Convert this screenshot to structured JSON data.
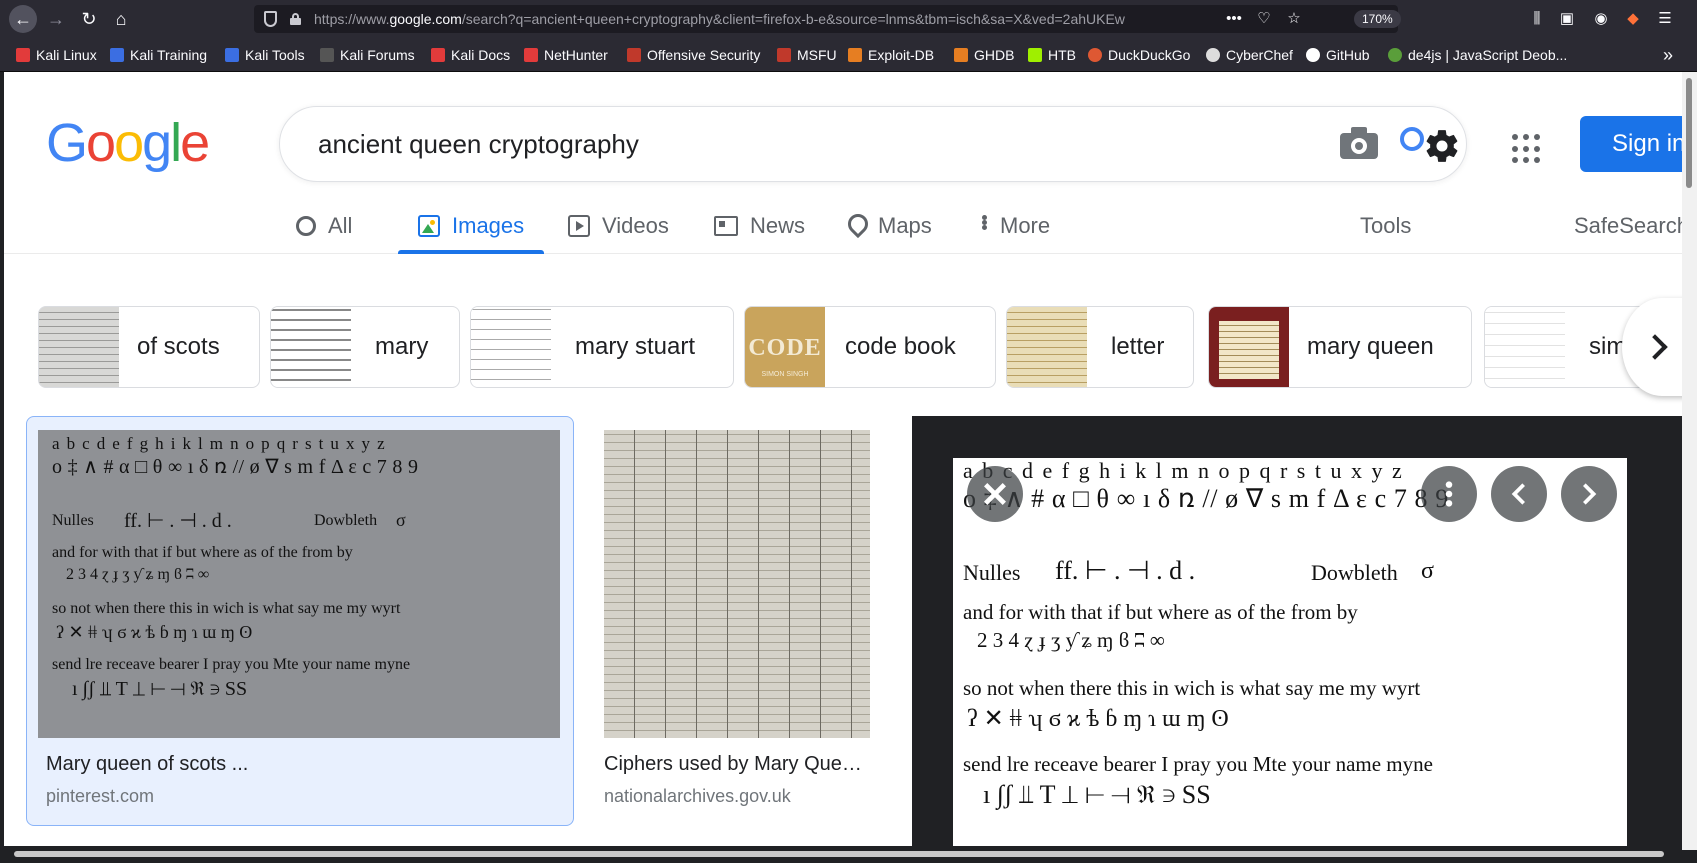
{
  "browser": {
    "url_prefix": "https://www.",
    "url_domain": "google.com",
    "url_rest": "/search?q=ancient+queen+cryptography&client=firefox-b-e&source=lnms&tbm=isch&sa=X&ved=2ahUKEw",
    "zoom": "170%",
    "bookmarks": [
      {
        "label": "Kali Linux",
        "color": "#e23b3b"
      },
      {
        "label": "Kali Training",
        "color": "#3b6ee2"
      },
      {
        "label": "Kali Tools",
        "color": "#3b6ee2"
      },
      {
        "label": "Kali Forums",
        "color": "#2b2a33"
      },
      {
        "label": "Kali Docs",
        "color": "#e23b3b"
      },
      {
        "label": "NetHunter",
        "color": "#e23b3b"
      },
      {
        "label": "Offensive Security",
        "color": "#c0392b"
      },
      {
        "label": "MSFU",
        "color": "#c0392b"
      },
      {
        "label": "Exploit-DB",
        "color": "#e67e22"
      },
      {
        "label": "GHDB",
        "color": "#e67e22"
      },
      {
        "label": "HTB",
        "color": "#9fef00"
      },
      {
        "label": "DuckDuckGo",
        "color": "#de5833"
      },
      {
        "label": "CyberChef",
        "color": "#dddddd"
      },
      {
        "label": "GitHub",
        "color": "#ffffff"
      },
      {
        "label": "de4js | JavaScript Deob...",
        "color": "#5a9e3a"
      }
    ]
  },
  "google": {
    "logo": {
      "letters": [
        "G",
        "o",
        "o",
        "g",
        "l",
        "e"
      ],
      "colors": [
        "#4285f4",
        "#ea4335",
        "#fbbc05",
        "#4285f4",
        "#34a853",
        "#ea4335"
      ]
    },
    "query": "ancient queen cryptography",
    "signin_label": "Sign in",
    "tabs": [
      {
        "label": "All",
        "icon": "search-icon"
      },
      {
        "label": "Images",
        "icon": "images-icon"
      },
      {
        "label": "Videos",
        "icon": "video-icon"
      },
      {
        "label": "News",
        "icon": "news-icon"
      },
      {
        "label": "Maps",
        "icon": "map-pin-icon"
      },
      {
        "label": "More",
        "icon": "more-vert-icon"
      }
    ],
    "tools_label": "Tools",
    "safesearch_label": "SafeSearch",
    "chips": [
      "of scots",
      "mary",
      "mary stuart",
      "code book",
      "letter",
      "mary queen",
      "sim"
    ],
    "code_book_thumb": {
      "word": "CODE",
      "author": "SIMON SINGH"
    },
    "results": [
      {
        "title": "Mary queen of scots ...",
        "source": "pinterest.com"
      },
      {
        "title": "Ciphers used by Mary Que…",
        "source": "nationalarchives.gov.uk"
      }
    ]
  },
  "cipher_sheet": {
    "alphabet": "a b c d e f g h i k l m n o p q r s t u x y z",
    "symbols": "o ‡ ∧ # α □ θ ∞ ı δ ռ // ø ∇ s m f Δ ε c 7 8 9",
    "nulles_label": "Nulles",
    "nulles_symbols": "ff. ⊢ . ⊣ . d .",
    "dowbleth_label": "Dowbleth",
    "dowbleth_symbol": "σ",
    "row1_words": "and   for  with  that  if   but  where  as   of  the  from  by",
    "row1_symbols": "2    3    4     ɀ   ɟ    ʒ   ƴ   ʑ   ɱ   ϐ   ʭ   ∞",
    "row2_words": "so  not  when  there this  in  wich  is   what  say  me  my  wyrt",
    "row2_symbols": "ʔ   ✕   ǂǂ   ʮ   ϭ   ϰ   ѣ   ɓ   ɱ   ɿ   ɯ   ɱ   ʘ",
    "row3_words": "send  lre  receave  bearer  I   pray  you  Mte   your name   myne",
    "row3_symbols": "ı  ∫ʃ  ⫫       T    ⊥   ⊢   ⊣   ℜ      ∋        SS"
  }
}
